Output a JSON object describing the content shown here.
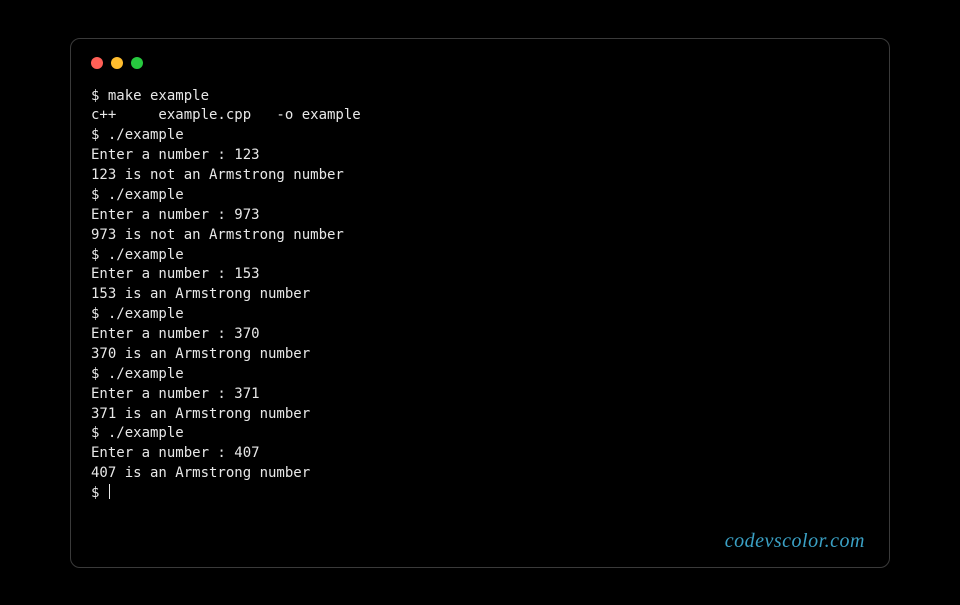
{
  "window_controls": {
    "close": "close",
    "minimize": "minimize",
    "maximize": "maximize"
  },
  "terminal": {
    "lines": [
      "$ make example",
      "c++     example.cpp   -o example",
      "$ ./example",
      "Enter a number : 123",
      "123 is not an Armstrong number",
      "$ ./example",
      "Enter a number : 973",
      "973 is not an Armstrong number",
      "$ ./example",
      "Enter a number : 153",
      "153 is an Armstrong number",
      "$ ./example",
      "Enter a number : 370",
      "370 is an Armstrong number",
      "$ ./example",
      "Enter a number : 371",
      "371 is an Armstrong number",
      "$ ./example",
      "Enter a number : 407",
      "407 is an Armstrong number"
    ],
    "prompt": "$ "
  },
  "watermark": "codevscolor.com"
}
